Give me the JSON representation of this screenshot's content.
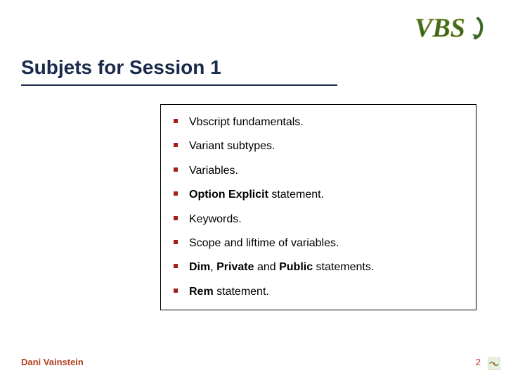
{
  "header": {
    "title": "Subjets for Session 1",
    "logo_text": "VBS"
  },
  "bullets": [
    {
      "segments": [
        {
          "text": "Vbscript fundamentals.",
          "bold": false
        }
      ]
    },
    {
      "segments": [
        {
          "text": "Variant subtypes.",
          "bold": false
        }
      ]
    },
    {
      "segments": [
        {
          "text": "Variables.",
          "bold": false
        }
      ]
    },
    {
      "segments": [
        {
          "text": "Option Explicit",
          "bold": true
        },
        {
          "text": " statement.",
          "bold": false
        }
      ]
    },
    {
      "segments": [
        {
          "text": "Keywords.",
          "bold": false
        }
      ]
    },
    {
      "segments": [
        {
          "text": "Scope and liftime of variables.",
          "bold": false
        }
      ]
    },
    {
      "segments": [
        {
          "text": "Dim",
          "bold": true
        },
        {
          "text": ", ",
          "bold": false
        },
        {
          "text": "Private",
          "bold": true
        },
        {
          "text": " and ",
          "bold": false
        },
        {
          "text": "Public",
          "bold": true
        },
        {
          "text": " statements.",
          "bold": false
        }
      ]
    },
    {
      "segments": [
        {
          "text": "Rem",
          "bold": true
        },
        {
          "text": " statement.",
          "bold": false
        }
      ]
    }
  ],
  "footer": {
    "author": "Dani Vainstein",
    "page_number": "2"
  }
}
